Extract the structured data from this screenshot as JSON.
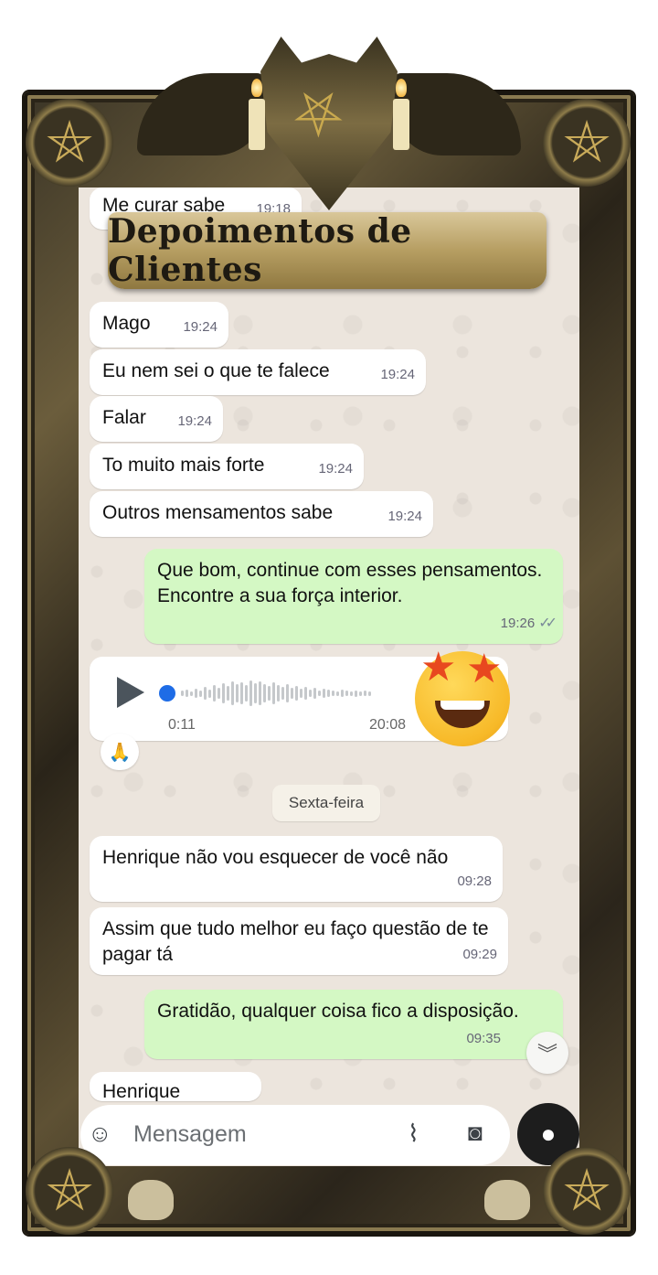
{
  "banner": {
    "title": "Depoimentos de Clientes"
  },
  "messages": [
    {
      "text": "Me curar sabe",
      "time": "19:18",
      "dir": "in"
    },
    {
      "text": "Mago",
      "time": "19:24",
      "dir": "in"
    },
    {
      "text": "Eu nem sei o que te falece",
      "time": "19:24",
      "dir": "in"
    },
    {
      "text": "Falar",
      "time": "19:24",
      "dir": "in"
    },
    {
      "text": "To muito mais forte",
      "time": "19:24",
      "dir": "in"
    },
    {
      "text": "Outros mensamentos sabe",
      "time": "19:24",
      "dir": "in"
    },
    {
      "text": "Que bom, continue com esses pensamentos. Encontre a sua força interior.",
      "time": "19:26",
      "dir": "out"
    },
    {
      "text": "Henrique não vou esquecer de você não",
      "time": "09:28",
      "dir": "in"
    },
    {
      "text": "Assim que tudo melhor eu faço questão de te pagar tá",
      "time": "09:29",
      "dir": "in"
    },
    {
      "text": "Gratidão, qualquer coisa fico a disposição.",
      "time": "09:35",
      "dir": "out"
    },
    {
      "text": "Henrique",
      "time": "",
      "dir": "in"
    }
  ],
  "voice_note": {
    "duration": "0:11",
    "time": "20:08",
    "reaction": "🙏"
  },
  "date_divider": "Sexta-feira",
  "input": {
    "placeholder": "Mensagem"
  },
  "icons": {
    "sticker": "sticker-icon",
    "attach": "paperclip-icon",
    "camera": "camera-icon",
    "mic": "mic-icon",
    "scroll": "chevron-double-down-icon",
    "play": "play-icon"
  },
  "colors": {
    "incoming": "#ffffff",
    "outgoing": "#d4f8c4",
    "chat_bg": "#ece5dd",
    "progress_dot": "#1e6ce6"
  }
}
